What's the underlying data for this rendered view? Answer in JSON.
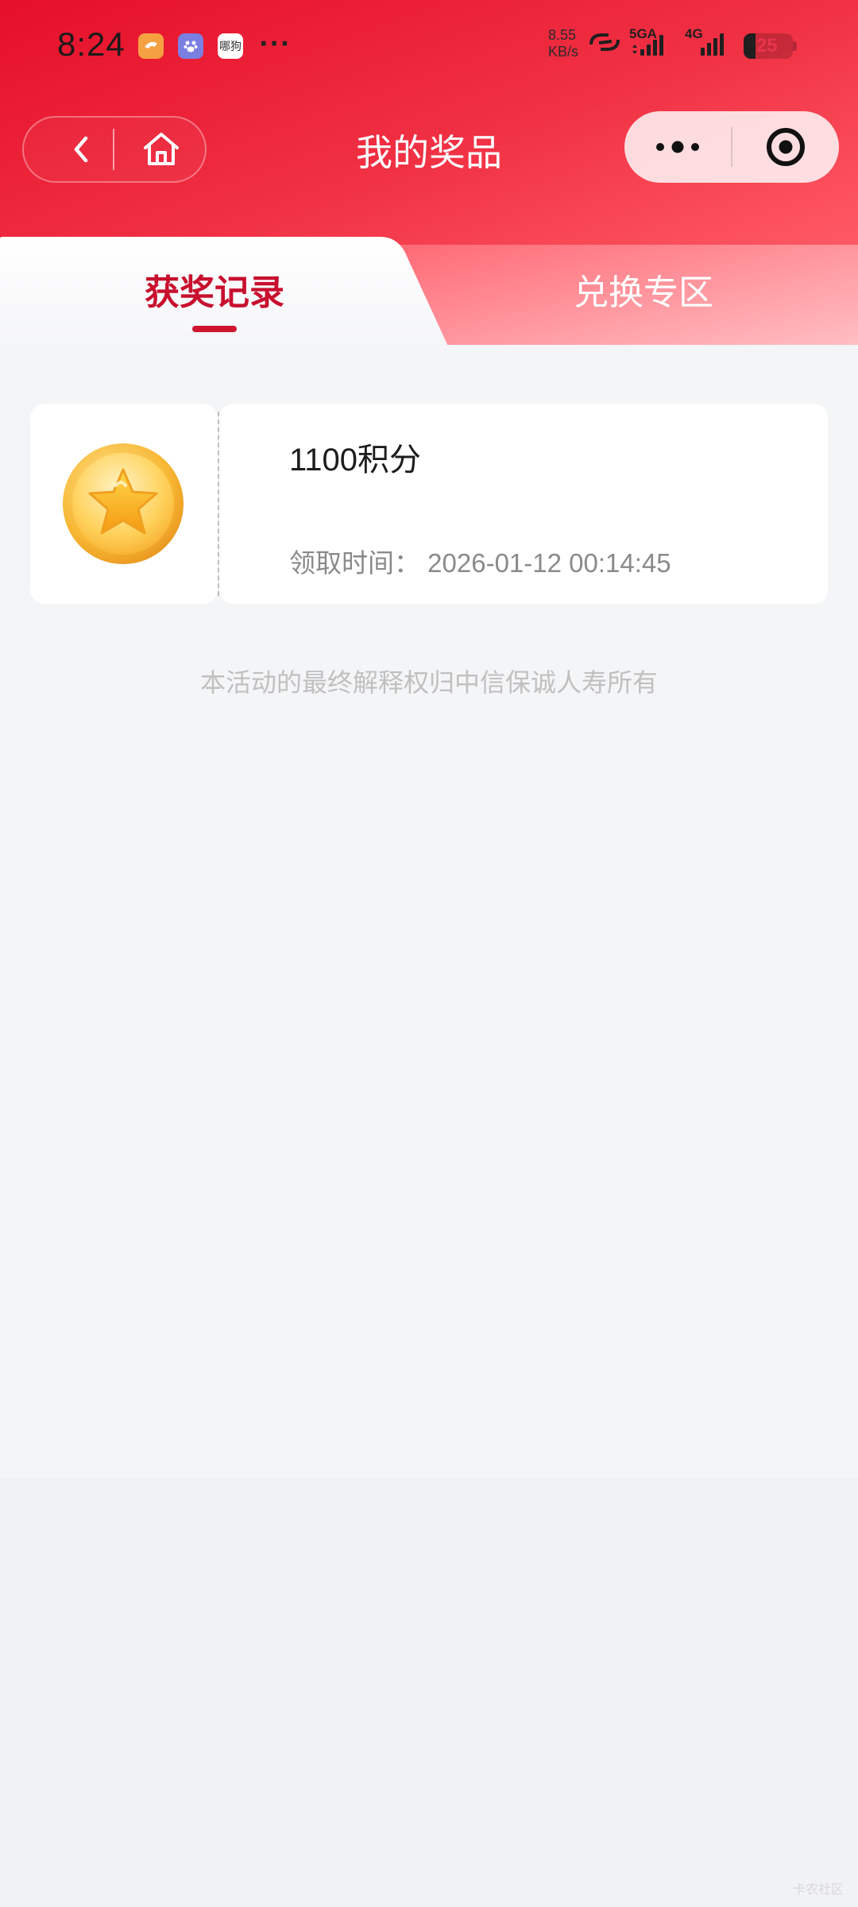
{
  "status_bar": {
    "time": "8:24",
    "more": "···",
    "net_speed_value": "8.55",
    "net_speed_unit": "KB/s",
    "signal_1": "5GA",
    "signal_2": "4G",
    "battery_level": "25",
    "app_icon_3_text": "哪狗"
  },
  "nav": {
    "title": "我的奖品"
  },
  "tabs": [
    {
      "label": "获奖记录",
      "active": true
    },
    {
      "label": "兑换专区",
      "active": false
    }
  ],
  "prizes": [
    {
      "name": "1100积分",
      "time_label": "领取时间：",
      "time_value": "2026-01-12 00:14:45",
      "icon": "star-coin-icon"
    }
  ],
  "footer_note": "本活动的最终解释权归中信保诚人寿所有",
  "watermark": "卡农社区",
  "colors": {
    "brand_red": "#e60f2a",
    "active_tab": "#c8102e",
    "page_bg": "#f4f5f7"
  }
}
